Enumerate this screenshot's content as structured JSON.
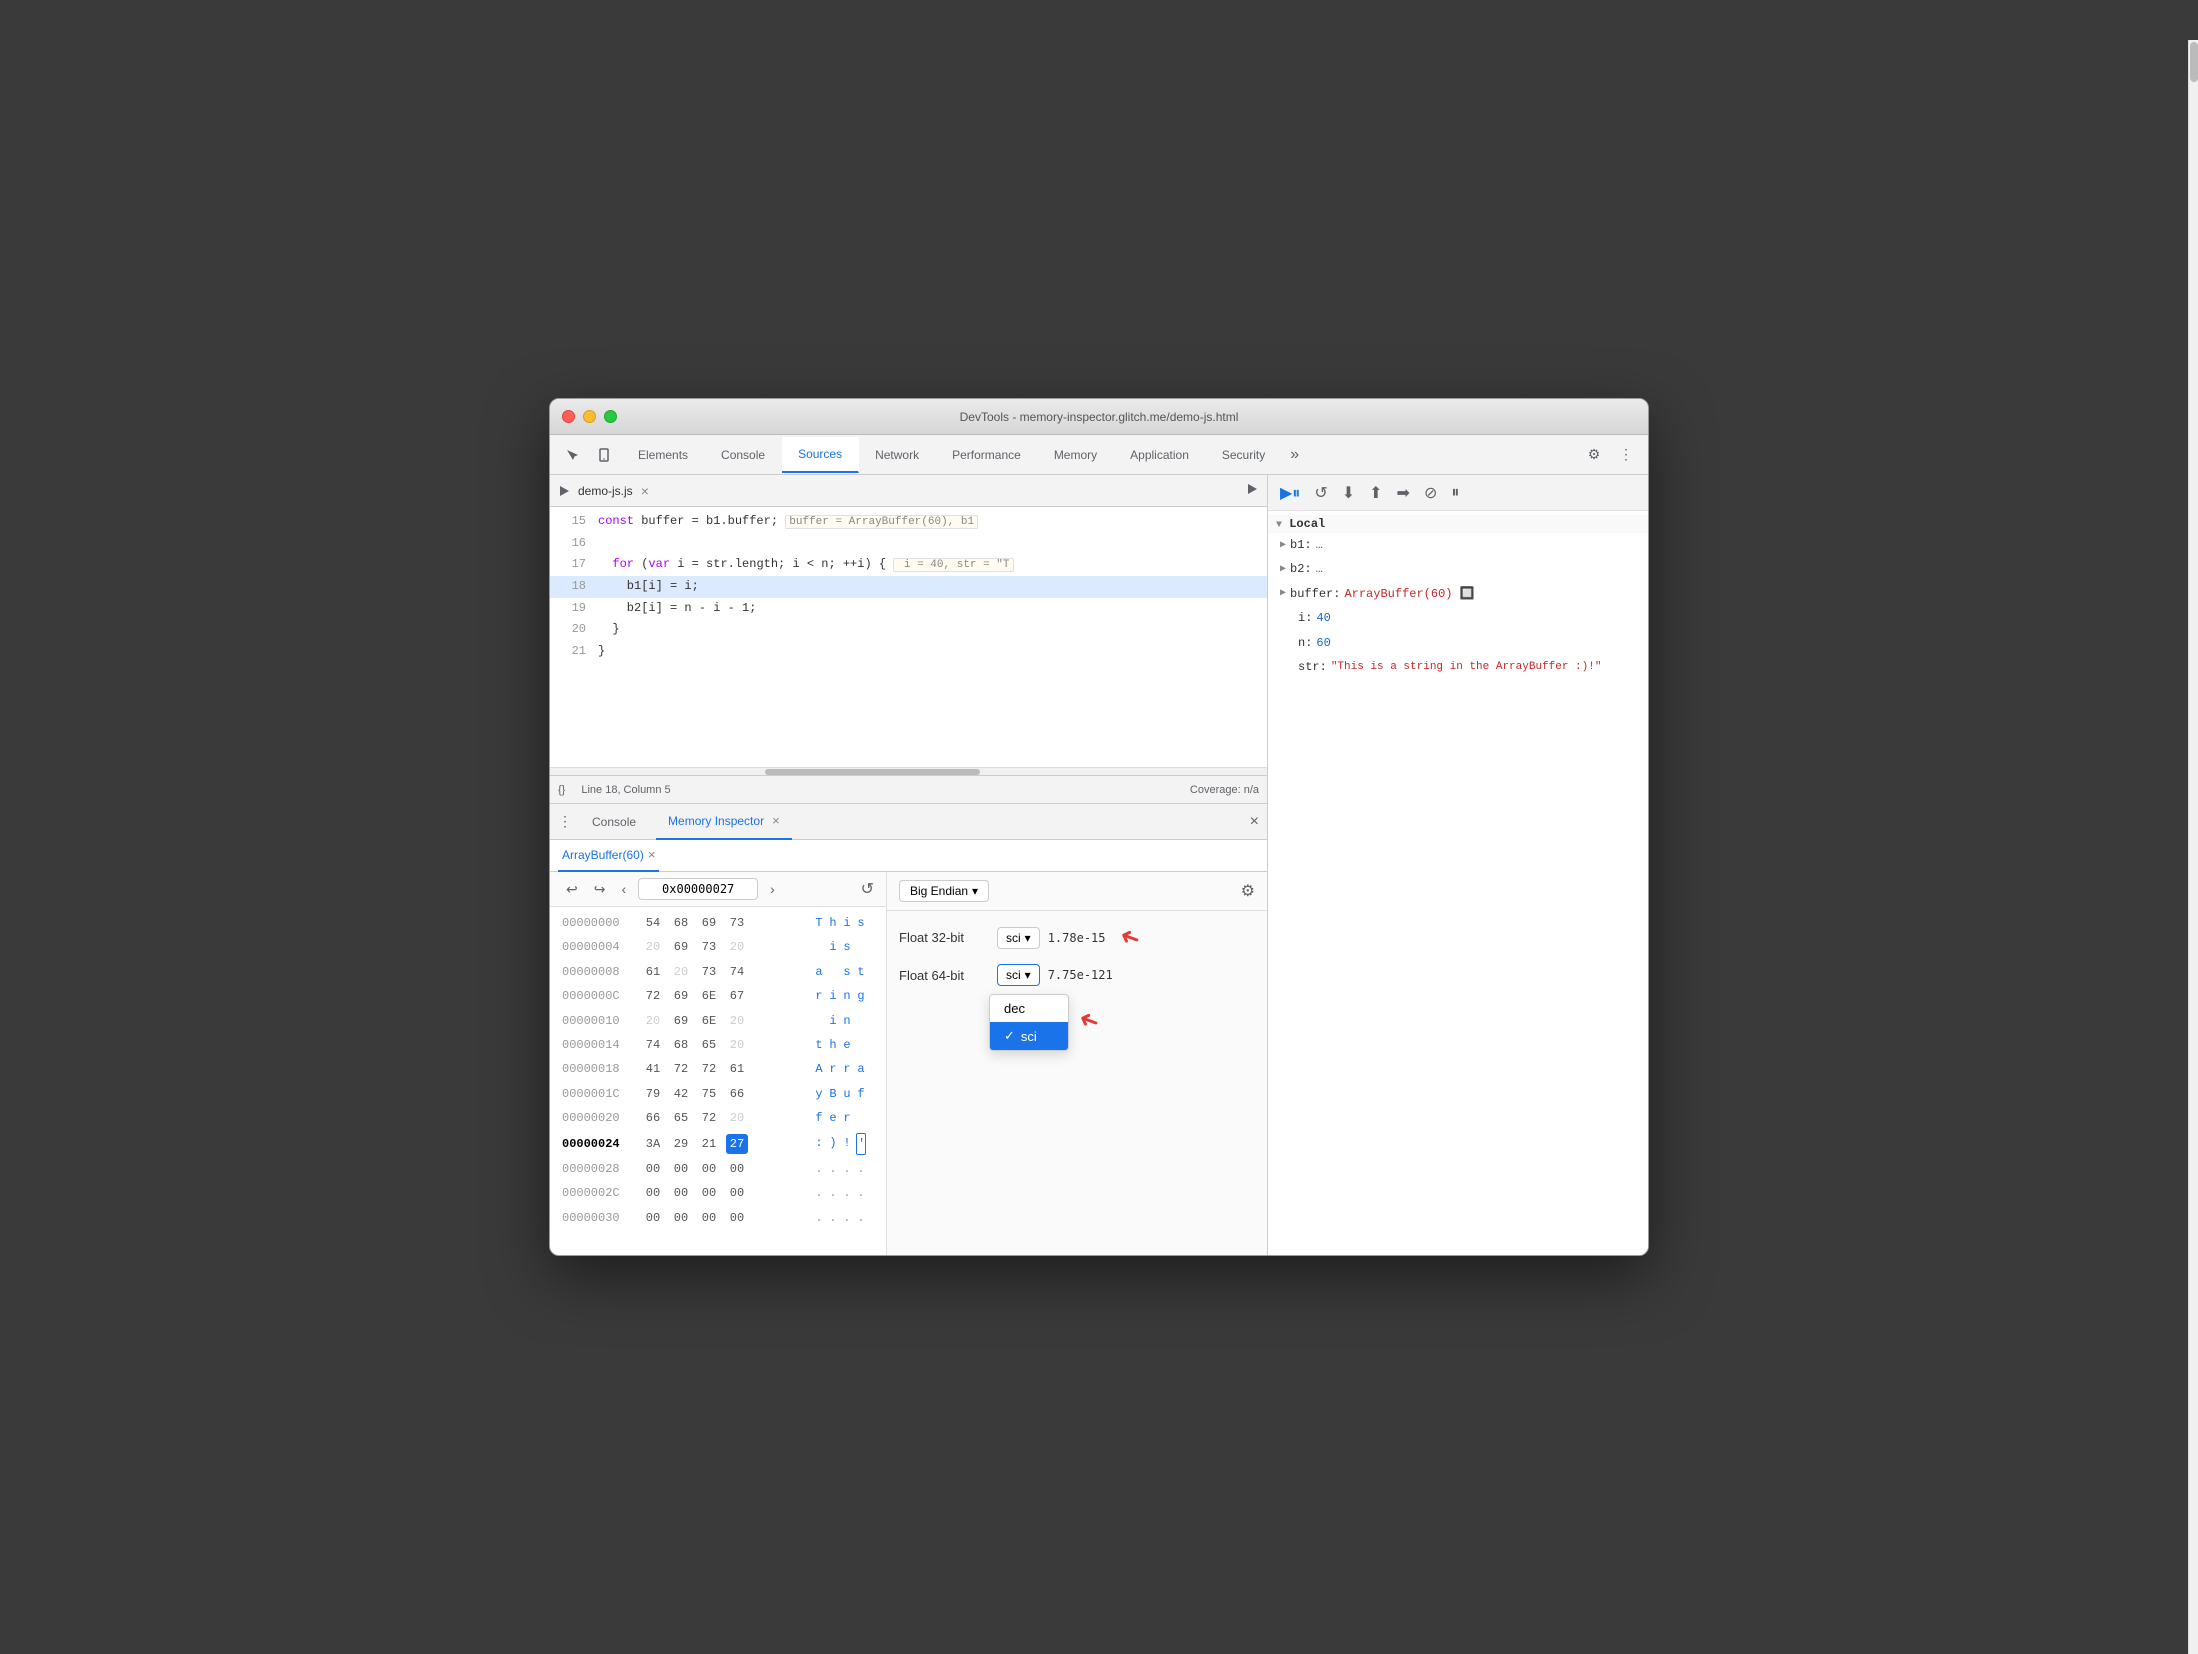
{
  "window": {
    "title": "DevTools - memory-inspector.glitch.me/demo-js.html"
  },
  "tabs": {
    "items": [
      "Elements",
      "Console",
      "Sources",
      "Network",
      "Performance",
      "Memory",
      "Application",
      "Security"
    ],
    "active": "Sources",
    "more": ">>"
  },
  "toolbar": {
    "icons": [
      "cursor",
      "mobile",
      "element-picker"
    ],
    "settings": "⚙",
    "more": "⋮"
  },
  "code": {
    "filename": "demo-js.js",
    "lines": [
      {
        "num": 15,
        "content": "  const buffer = b1.buffer;  buffer = ArrayBuffer(60), b1",
        "highlighted": false
      },
      {
        "num": 16,
        "content": "",
        "highlighted": false
      },
      {
        "num": 17,
        "content": "  for (var i = str.length; i < n; ++i) {  i = 40, str = \"T",
        "highlighted": false
      },
      {
        "num": 18,
        "content": "    b1[i] = i;",
        "highlighted": true
      },
      {
        "num": 19,
        "content": "    b2[i] = n - i - 1;",
        "highlighted": false
      },
      {
        "num": 20,
        "content": "  }",
        "highlighted": false
      },
      {
        "num": 21,
        "content": "}",
        "highlighted": false
      }
    ]
  },
  "statusbar": {
    "line_col": "Line 18, Column 5",
    "coverage": "Coverage: n/a",
    "braces": "{}"
  },
  "debug_toolbar": {
    "buttons": [
      "▶",
      "⟳",
      "⬇",
      "⬆",
      "➡",
      "⊘",
      "⏸"
    ]
  },
  "scope": {
    "section": "Local",
    "items": [
      {
        "key": "b1:",
        "value": "…"
      },
      {
        "key": "b2:",
        "value": "…"
      },
      {
        "key": "buffer:",
        "value": "ArrayBuffer(60) 🔲"
      },
      {
        "key": "i:",
        "value": "40",
        "type": "num"
      },
      {
        "key": "n:",
        "value": "60",
        "type": "num"
      },
      {
        "key": "str:",
        "value": "\"This is a string in the ArrayBuffer :)!\"",
        "type": "str"
      }
    ]
  },
  "bottom_tabs": {
    "console_label": "Console",
    "mi_label": "Memory Inspector"
  },
  "memory_tab": {
    "buffer_label": "ArrayBuffer(60)"
  },
  "hex_toolbar": {
    "nav_back": "‹",
    "nav_fwd": "›",
    "address": "0x00000027",
    "refresh": "↺",
    "undo": "↩",
    "redo": "↪"
  },
  "hex_rows": [
    {
      "offset": "00000000",
      "bytes": [
        "54",
        "68",
        "69",
        "73"
      ],
      "chars": [
        "T",
        "h",
        "i",
        "s"
      ],
      "active": false
    },
    {
      "offset": "00000004",
      "bytes": [
        "20",
        "69",
        "73",
        "20"
      ],
      "chars": [
        " ",
        "i",
        "s",
        " "
      ],
      "active": false
    },
    {
      "offset": "00000008",
      "bytes": [
        "61",
        "20",
        "73",
        "74"
      ],
      "chars": [
        "a",
        " ",
        "s",
        "t"
      ],
      "active": false
    },
    {
      "offset": "0000000C",
      "bytes": [
        "72",
        "69",
        "6E",
        "67"
      ],
      "chars": [
        "r",
        "i",
        "n",
        "g"
      ],
      "active": false
    },
    {
      "offset": "00000010",
      "bytes": [
        "20",
        "69",
        "6E",
        "20"
      ],
      "chars": [
        " ",
        "i",
        "n",
        " "
      ],
      "active": false
    },
    {
      "offset": "00000014",
      "bytes": [
        "74",
        "68",
        "65",
        "20"
      ],
      "chars": [
        "t",
        "h",
        "e",
        " "
      ],
      "active": false
    },
    {
      "offset": "00000018",
      "bytes": [
        "41",
        "72",
        "72",
        "61"
      ],
      "chars": [
        "A",
        "r",
        "r",
        "a"
      ],
      "active": false
    },
    {
      "offset": "0000001C",
      "bytes": [
        "79",
        "42",
        "75",
        "66"
      ],
      "chars": [
        "y",
        "B",
        "u",
        "f"
      ],
      "active": false
    },
    {
      "offset": "00000020",
      "bytes": [
        "66",
        "65",
        "72",
        "20"
      ],
      "chars": [
        "f",
        "e",
        "r",
        " "
      ],
      "active": false
    },
    {
      "offset": "00000024",
      "bytes": [
        "3A",
        "29",
        "21",
        "27"
      ],
      "chars": [
        ":",
        ")",
        " ",
        "'"
      ],
      "active": true,
      "active_byte_idx": 3
    },
    {
      "offset": "00000028",
      "bytes": [
        "00",
        "00",
        "00",
        "00"
      ],
      "chars": [
        ".",
        ".",
        ".",
        "."
      ]
    },
    {
      "offset": "0000002C",
      "bytes": [
        "00",
        "00",
        "00",
        "00"
      ],
      "chars": [
        ".",
        ".",
        ".",
        "."
      ]
    },
    {
      "offset": "00000030",
      "bytes": [
        "00",
        "00",
        "00",
        "00"
      ],
      "chars": [
        ".",
        ".",
        ".",
        "."
      ]
    }
  ],
  "inspect": {
    "endian": "Big Endian",
    "float32": {
      "label": "Float 32-bit",
      "format": "sci",
      "value": "1.78e-15"
    },
    "float64": {
      "label": "Float 64-bit",
      "format": "sci",
      "value": "7.75e-121"
    },
    "dropdown": {
      "options": [
        "dec",
        "sci"
      ],
      "selected": "sci",
      "visible": true
    }
  }
}
